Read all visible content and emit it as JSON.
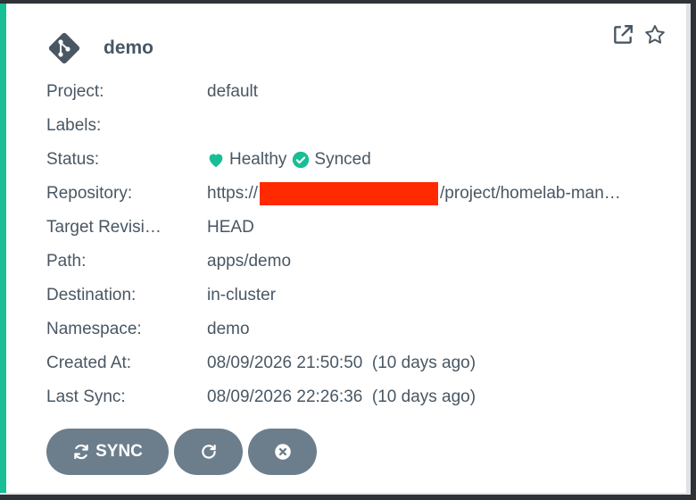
{
  "app": {
    "name": "demo",
    "icon": "git-icon"
  },
  "fields": {
    "project": {
      "label": "Project:",
      "value": "default"
    },
    "labels": {
      "label": "Labels:",
      "value": ""
    },
    "status": {
      "label": "Status:",
      "health": "Healthy",
      "sync": "Synced"
    },
    "repository": {
      "label": "Repository:",
      "prefix": "https://",
      "suffix": "/project/homelab-man…"
    },
    "target_revision": {
      "label": "Target Revisi…",
      "value": "HEAD"
    },
    "path": {
      "label": "Path:",
      "value": "apps/demo"
    },
    "destination": {
      "label": "Destination:",
      "value": "in-cluster"
    },
    "namespace": {
      "label": "Namespace:",
      "value": "demo"
    },
    "created_at": {
      "label": "Created At:",
      "value": "08/09/2026 21:50:50  (10 days ago)"
    },
    "last_sync": {
      "label": "Last Sync:",
      "value": "08/09/2026 22:26:36  (10 days ago)"
    }
  },
  "buttons": {
    "sync_label": "SYNC"
  },
  "colors": {
    "accent": "#18be94",
    "text": "#495763",
    "button": "#6c7e8c",
    "redaction": "#ff2a00"
  }
}
